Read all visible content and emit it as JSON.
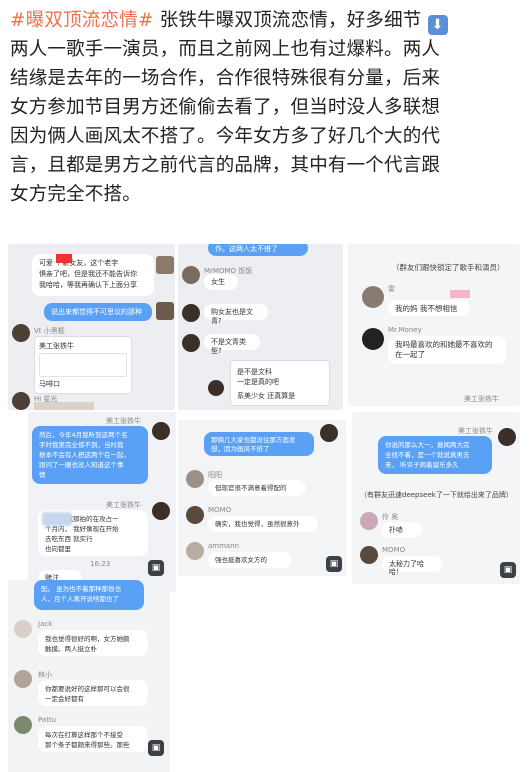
{
  "post": {
    "hashtag": "#曝双顶流恋情#",
    "line1_rest": " 张铁牛曝双顶流恋情，好多细节",
    "download_icon": "down-arrow-icon",
    "line2": "两人一歌手一演员，而且之前网上也有过爆料。两人",
    "line3": "结缘是去年的一场合作，合作很特殊很有分量，后来",
    "line4": "女方参加节目男方还偷偷去看了，但当时没人多联想",
    "line5": "因为俩人画风太不搭了。今年女方多了好几个大的代",
    "line6": "言，且都是男方之前代言的品牌，其中有一个代言跟",
    "line7": "女方完全不搭。"
  },
  "panel1": {
    "q_bubble": "可爱      个新女友，这个老字\n惧亲了吧，但是我还不能告诉你\n我哈哈，等我再确认下上面分享",
    "reply1": "说出来都觉得不可思议的那种",
    "name1": "Vt  小黑框",
    "card_name": "美工张铁牛",
    "card_text": "马啡口",
    "name2": "Hi 星光"
  },
  "panel2": {
    "top_bubble": "作。这两人太不搭了",
    "name1": "MrMOMO 饭饭",
    "msg1": "女生",
    "msg2": "购女友也是文青?",
    "msg3": "不是文青类型?",
    "card_line1": "是不是文科  ",
    "card_line2": "一定是真的吧",
    "card_msg": "系美少女 还真算是"
  },
  "panel3": {
    "header": "（群友们跟快锁定了歌手和演员）",
    "name1": "雷",
    "msg1": "我的妈  我不想相信",
    "name2": "Mr.Money",
    "msg2": "我吗最喜欢的和她最不喜欢的\n在一起了",
    "label": "美工张铁牛"
  },
  "panel4": {
    "label": "美工张铁牛",
    "msg1": "然后，今年4月我听到这两个名\n字时我第完全惊不到，当时我\n根本不会有人把这两个在一起，\n跟问了一圈也没人知道这个事\n情",
    "label2": "美工张铁牛",
    "msg2": "  未消，  我那拍的在攻占一\n个月内，  我好像现在开始\n去吃东西   就实行\n也向都里",
    "time": "16:23",
    "msg3": "赌注"
  },
  "panel5": {
    "msg1": "那俩几大家也都没往那方面发\n想，因为画风不搭了",
    "name1": "阳阳",
    "msg2": "但现官很不满意着得配的",
    "name2": "MOMO",
    "msg3": "确实，我也觉得，虽然很意外",
    "name3": "ammann",
    "msg4": "强也挺喜欢女方的"
  },
  "panel6": {
    "label": "美工张铁牛",
    "msg1": "你说的那么大一，据闻两大完\n全找不着，是一个就说真男去\n来，  听许子闹着留乐多久",
    "header": "（有群友迅速deepseek了一下就给出来了品牌）",
    "name1": "伶  奥",
    "msg2": "扑哧",
    "name2": "MOMO",
    "msg3": "太秘力了哈哈！"
  },
  "panel7": {
    "msg1": "配。  虽为也不着那种那很也\n人，且个人离开说啥都也了",
    "name1": "Jack",
    "msg2": "我也觉得很好的啊，女方她颇\n触摸。两人挺立朴",
    "name2": "林小",
    "msg3": "你都要说好的这样那可以会很\n一定会好都有",
    "name3": "Pattu",
    "msg4": "每次在打算这样那个不接受\n那个条子都颇来得那些。那些"
  }
}
